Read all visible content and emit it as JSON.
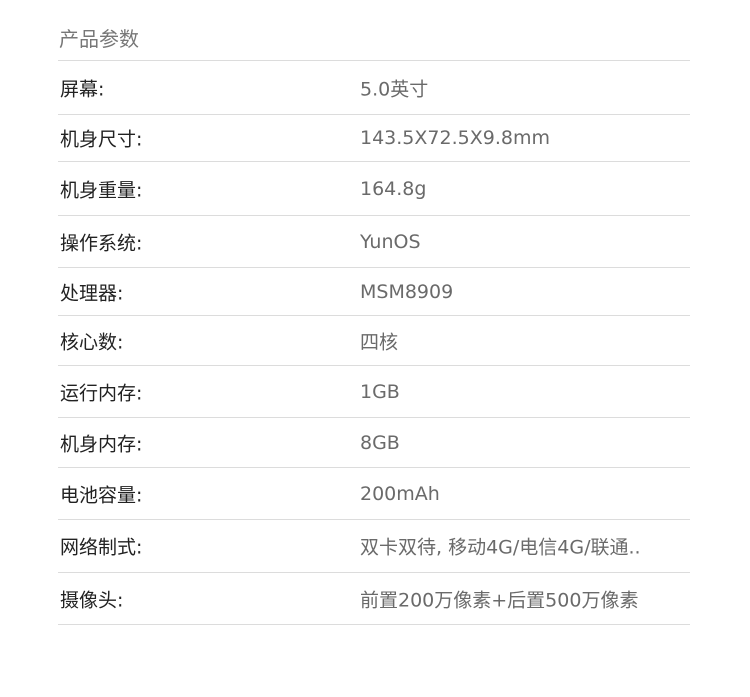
{
  "section": {
    "title": "产品参数"
  },
  "specs": [
    {
      "label": "屏幕:",
      "value": "5.0英寸"
    },
    {
      "label": "机身尺寸:",
      "value": "143.5X72.5X9.8mm"
    },
    {
      "label": "机身重量:",
      "value": "164.8g"
    },
    {
      "label": "操作系统:",
      "value": "YunOS"
    },
    {
      "label": "处理器:",
      "value": "MSM8909"
    },
    {
      "label": "核心数:",
      "value": "四核"
    },
    {
      "label": "运行内存:",
      "value": "1GB"
    },
    {
      "label": "机身内存:",
      "value": "8GB"
    },
    {
      "label": "电池容量:",
      "value": "200mAh"
    },
    {
      "label": "网络制式:",
      "value": "双卡双待, 移动4G/电信4G/联通.."
    },
    {
      "label": "摄像头:",
      "value": "前置200万像素+后置500万像素"
    }
  ]
}
